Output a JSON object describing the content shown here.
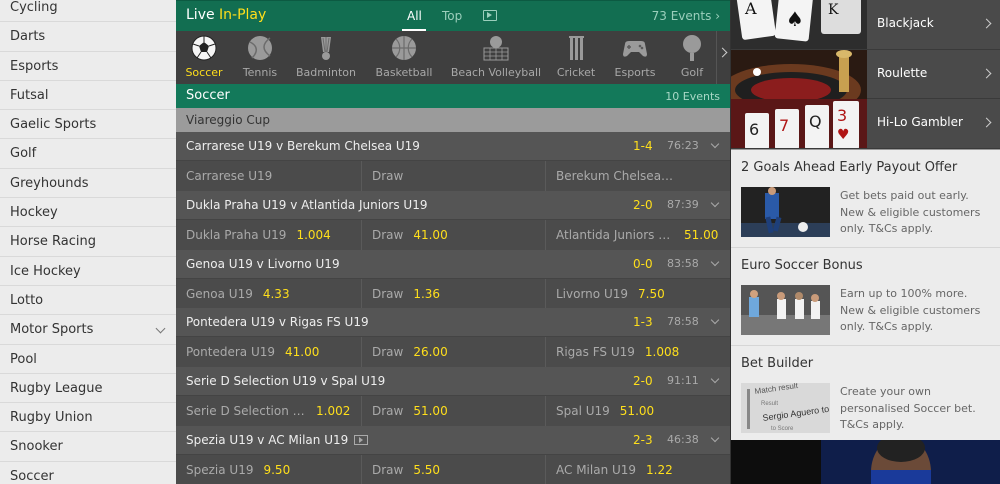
{
  "sidebar": {
    "items": [
      {
        "label": "Cycling"
      },
      {
        "label": "Darts"
      },
      {
        "label": "Esports"
      },
      {
        "label": "Futsal"
      },
      {
        "label": "Gaelic Sports"
      },
      {
        "label": "Golf"
      },
      {
        "label": "Greyhounds"
      },
      {
        "label": "Hockey"
      },
      {
        "label": "Horse Racing"
      },
      {
        "label": "Ice Hockey"
      },
      {
        "label": "Lotto"
      },
      {
        "label": "Motor Sports"
      },
      {
        "label": "Pool"
      },
      {
        "label": "Rugby League"
      },
      {
        "label": "Rugby Union"
      },
      {
        "label": "Snooker"
      },
      {
        "label": "Soccer"
      }
    ]
  },
  "header": {
    "live": "Live",
    "inplay": "In-Play",
    "tab_all": "All",
    "tab_top": "Top",
    "events": "73 Events"
  },
  "sports": [
    {
      "label": "Soccer",
      "icon": "soccer-ball-icon"
    },
    {
      "label": "Tennis",
      "icon": "tennis-ball-icon"
    },
    {
      "label": "Badminton",
      "icon": "shuttlecock-icon"
    },
    {
      "label": "Basketball",
      "icon": "basketball-icon"
    },
    {
      "label": "Beach Volleyball",
      "icon": "beach-volleyball-icon"
    },
    {
      "label": "Cricket",
      "icon": "cricket-icon"
    },
    {
      "label": "Esports",
      "icon": "gamepad-icon"
    },
    {
      "label": "Golf",
      "icon": "golf-icon"
    }
  ],
  "section": {
    "title": "Soccer",
    "count": "10 Events"
  },
  "competition": {
    "title": "Viareggio Cup"
  },
  "matches": [
    {
      "name": "Carrarese U19 v Berekum Chelsea U19",
      "score": "1-4",
      "time": "76:23",
      "home": "Carrarese U19",
      "home_price": "",
      "draw": "Draw",
      "draw_price": "",
      "away": "Berekum Chelsea U19",
      "away_price": "",
      "tv": false
    },
    {
      "name": "Dukla Praha U19 v Atlantida Juniors U19",
      "score": "2-0",
      "time": "87:39",
      "home": "Dukla Praha U19",
      "home_price": "1.004",
      "draw": "Draw",
      "draw_price": "41.00",
      "away": "Atlantida Juniors U19",
      "away_price": "51.00",
      "tv": false
    },
    {
      "name": "Genoa U19 v Livorno U19",
      "score": "0-0",
      "time": "83:58",
      "home": "Genoa U19",
      "home_price": "4.33",
      "draw": "Draw",
      "draw_price": "1.36",
      "away": "Livorno U19",
      "away_price": "7.50",
      "tv": false
    },
    {
      "name": "Pontedera U19 v Rigas FS U19",
      "score": "1-3",
      "time": "78:58",
      "home": "Pontedera U19",
      "home_price": "41.00",
      "draw": "Draw",
      "draw_price": "26.00",
      "away": "Rigas FS U19",
      "away_price": "1.008",
      "tv": false
    },
    {
      "name": "Serie D Selection U19 v Spal U19",
      "score": "2-0",
      "time": "91:11",
      "home": "Serie D Selection U19",
      "home_price": "1.002",
      "draw": "Draw",
      "draw_price": "51.00",
      "away": "Spal U19",
      "away_price": "51.00",
      "tv": false
    },
    {
      "name": "Spezia U19 v AC Milan U19",
      "score": "2-3",
      "time": "46:38",
      "home": "Spezia U19",
      "home_price": "9.50",
      "draw": "Draw",
      "draw_price": "5.50",
      "away": "AC Milan U19",
      "away_price": "1.22",
      "tv": true
    }
  ],
  "games": [
    {
      "label": "Blackjack"
    },
    {
      "label": "Roulette"
    },
    {
      "label": "Hi-Lo Gambler"
    }
  ],
  "offers": [
    {
      "title": "2 Goals Ahead Early Payout Offer",
      "desc": "Get bets paid out early. New & eligible customers only. T&Cs apply."
    },
    {
      "title": "Euro Soccer Bonus",
      "desc": "Earn up to 100% more. New & eligible customers only. T&Cs apply."
    },
    {
      "title": "Bet Builder",
      "desc": "Create your own personalised Soccer bet. T&Cs apply."
    }
  ],
  "betbuilder_img": {
    "line1": "Match result",
    "line2": "Result",
    "line3": "Sergio Aguero to",
    "line4": "to Score"
  },
  "colors": {
    "brand_green": "#126e51",
    "accent_yellow": "#ffdf1b"
  }
}
